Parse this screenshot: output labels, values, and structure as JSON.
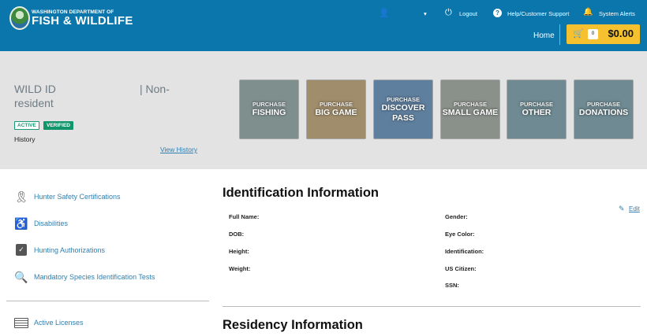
{
  "header": {
    "logo_line1": "WASHINGTON DEPARTMENT OF",
    "logo_line2": "FISH & WILDLIFE",
    "user_dropdown": "▾",
    "logout": "Logout",
    "help": "Help/Customer Support",
    "alerts": "System Alerts",
    "home": "Home",
    "cart_count": "0",
    "cart_total": "$0.00"
  },
  "profile": {
    "wild_id": "WILD ID",
    "residency": "| Non-",
    "residency_cont": "resident",
    "badge_active": "ACTIVE",
    "badge_verified": "VERIFIED",
    "history_label": "History",
    "view_history": "View History"
  },
  "tiles": [
    {
      "top": "PURCHASE",
      "name": "FISHING",
      "bg": "#7f8f8e"
    },
    {
      "top": "PURCHASE",
      "name": "BIG GAME",
      "bg": "#a08d6b"
    },
    {
      "top": "PURCHASE",
      "name": "DISCOVER PASS",
      "bg": "#5f7f9e"
    },
    {
      "top": "PURCHASE",
      "name": "SMALL GAME",
      "bg": "#8a908a"
    },
    {
      "top": "PURCHASE",
      "name": "OTHER",
      "bg": "#6f8a92"
    },
    {
      "top": "PURCHASE",
      "name": "DONATIONS",
      "bg": "#6f8a92"
    }
  ],
  "sidebar": {
    "items": [
      {
        "label": "Hunter Safety Certifications",
        "icon": "ribbon-icon"
      },
      {
        "label": "Disabilities",
        "icon": "wheelchair-icon"
      },
      {
        "label": "Hunting Authorizations",
        "icon": "clipboard-check-icon"
      },
      {
        "label": "Mandatory Species Identification Tests",
        "icon": "species-search-icon"
      }
    ],
    "active_licenses": "Active Licenses"
  },
  "identification": {
    "title": "Identification Information",
    "edit": "Edit",
    "left_fields": [
      "Full Name:",
      "DOB:",
      "Height:",
      "Weight:"
    ],
    "right_fields": [
      "Gender:",
      "Eye Color:",
      "Identification:",
      "US Citizen:",
      "SSN:"
    ]
  },
  "residency": {
    "title": "Residency Information"
  }
}
